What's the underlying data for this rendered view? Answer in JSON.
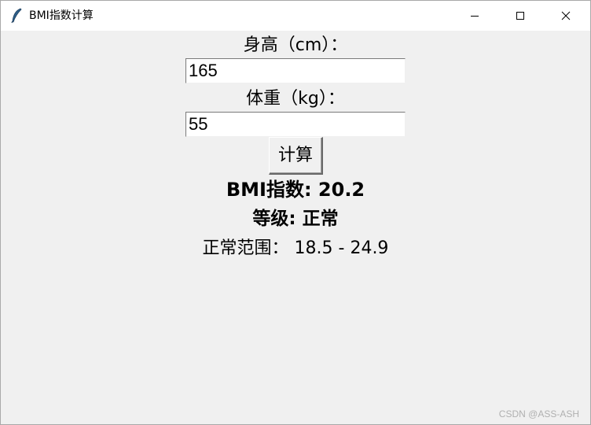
{
  "window": {
    "title": "BMI指数计算"
  },
  "form": {
    "height_label": "身高（cm）：",
    "height_value": "165",
    "weight_label": "体重（kg）：",
    "weight_value": "55",
    "calculate_label": "计算"
  },
  "result": {
    "bmi_text": "BMI指数: 20.2",
    "level_text": "等级: 正常",
    "range_text": "正常范围： 18.5 - 24.9"
  },
  "watermark": "CSDN @ASS-ASH",
  "icons": {
    "app": "feather-icon",
    "minimize": "minimize-icon",
    "maximize": "maximize-icon",
    "close": "close-icon"
  }
}
